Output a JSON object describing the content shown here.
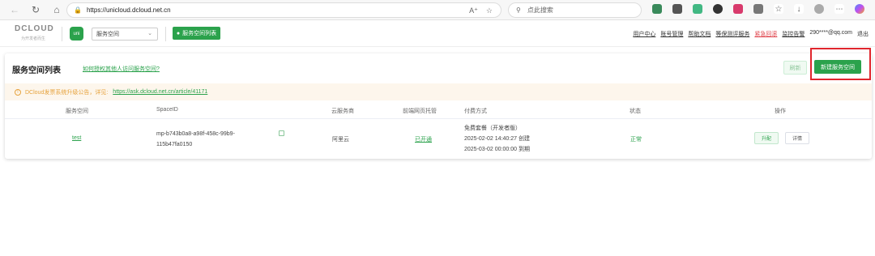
{
  "browser": {
    "url": "https://unicloud.dcloud.net.cn",
    "search_placeholder": "点此搜索"
  },
  "header": {
    "logo_text": "DCLOUD",
    "logo_sub": "为开发者而生",
    "uni_badge": "uni",
    "space_select_value": "服务空间",
    "space_list_label": "服务空间列表",
    "links": {
      "user_center": "用户中心",
      "account": "账号管理",
      "help": "帮助文档",
      "review": "等保测评服务",
      "emergency": "紧急回滚",
      "monitor": "监控告警"
    },
    "user_email": "290****@qq.com",
    "logout": "退出"
  },
  "card": {
    "title": "服务空间列表",
    "auth_link": "如何授权其他人访问服务空间?",
    "refresh_label": "刷新",
    "new_space_label": "新建服务空间",
    "notice_text": "DCloud发票系统升级公告，详见:",
    "notice_link": "https://ask.dcloud.net.cn/article/41171"
  },
  "table": {
    "headers": {
      "name": "服务空间",
      "space_id": "SpaceID",
      "provider": "云服务商",
      "hosting": "前端网页托管",
      "payment": "付费方式",
      "status": "状态",
      "actions": "操作"
    },
    "rows": [
      {
        "name": "test",
        "space_id_line1": "mp-b743b0a8-a98f-458c-99b9-",
        "space_id_line2": "115b47fa0150",
        "provider": "阿里云",
        "hosting": "已开通",
        "pay_plan": "免费套餐（开发者版）",
        "created": "2025-02-02 14:40:27 创建",
        "expires": "2025-03-02 00:00:00 到期",
        "status": "正常",
        "upgrade_label": "升配",
        "detail_label": "详情"
      }
    ]
  },
  "colors": {
    "brand_green": "#2ba24c",
    "highlight_red": "#e0262d",
    "notice_bg": "#fdf6ec"
  }
}
